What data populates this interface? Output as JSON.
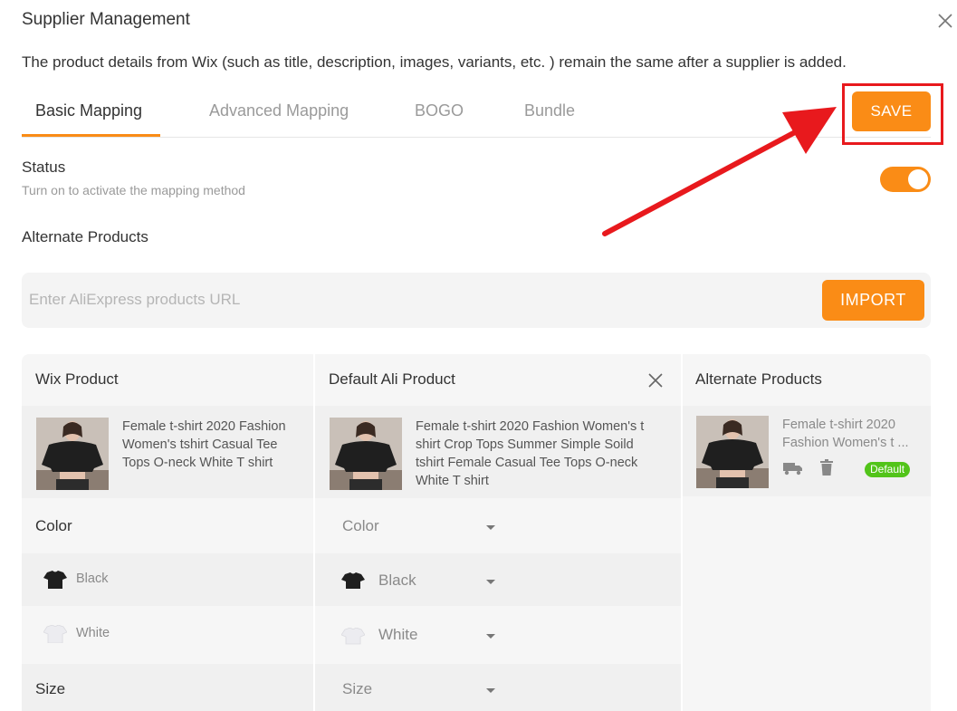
{
  "dialog": {
    "title": "Supplier Management",
    "description": "The product details from Wix (such as title, description, images, variants, etc. ) remain the same after a supplier is added."
  },
  "tabs": [
    {
      "label": "Basic Mapping",
      "active": true
    },
    {
      "label": "Advanced Mapping",
      "active": false
    },
    {
      "label": "BOGO",
      "active": false
    },
    {
      "label": "Bundle",
      "active": false
    }
  ],
  "save_button": {
    "label": "SAVE"
  },
  "status": {
    "label": "Status",
    "hint": "Turn on to activate the mapping method",
    "enabled": true
  },
  "alternate_products_section": {
    "label": "Alternate Products",
    "url_placeholder": "Enter AliExpress products URL",
    "url_value": "",
    "import_label": "IMPORT"
  },
  "table": {
    "headers": {
      "wix": "Wix Product",
      "ali": "Default Ali Product",
      "alternate": "Alternate Products"
    },
    "wix_product": {
      "title": "Female t-shirt 2020 Fashion Women's tshirt Casual Tee Tops O-neck White T shirt"
    },
    "ali_product": {
      "title": "Female t-shirt 2020 Fashion Women's t shirt Crop Tops Summer Simple Soild tshirt Female Casual Tee Tops O-neck White T shirt"
    },
    "alternate_product": {
      "title": "Female t-shirt 2020 Fashion Women's t ...",
      "badge": "Default"
    },
    "options": [
      {
        "wix": "Color",
        "ali": "Color"
      },
      {
        "wix": "Black",
        "ali": "Black",
        "swatch": "#1f1f1f"
      },
      {
        "wix": "White",
        "ali": "White",
        "swatch": "#f1f1f4"
      },
      {
        "wix": "Size",
        "ali": "Size"
      }
    ]
  },
  "colors": {
    "accent": "#fa8c16",
    "highlight": "#e8191d",
    "badge": "#52c41a"
  }
}
